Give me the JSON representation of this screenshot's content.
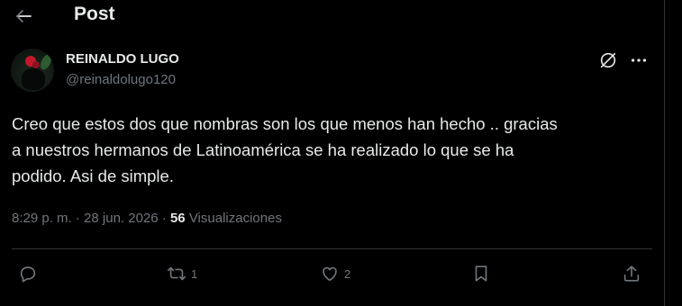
{
  "header": {
    "title": "Post"
  },
  "post": {
    "author_name": "REINALDO LUGO",
    "author_handle": "@reinaldolugo120",
    "text": "Creo que estos dos que nombras son los que menos han hecho .. gracias\na nuestros hermanos de Latinoamérica se ha realizado lo que se ha\npodido. Asi de simple.",
    "time": "8:29 p. m.",
    "separator": "·",
    "date": "28 jun. 2026",
    "views_count": "56",
    "views_label": "Visualizaciones"
  },
  "actions": {
    "reply_count": "",
    "repost_count": "1",
    "like_count": "2"
  },
  "icons": [
    "back-arrow-icon",
    "grok-icon",
    "more-icon",
    "reply-icon",
    "repost-icon",
    "like-icon",
    "bookmark-icon",
    "share-icon"
  ],
  "colors": {
    "background": "#000000",
    "text": "#e7e9ea",
    "secondary": "#71767b",
    "border": "#2f3336"
  }
}
